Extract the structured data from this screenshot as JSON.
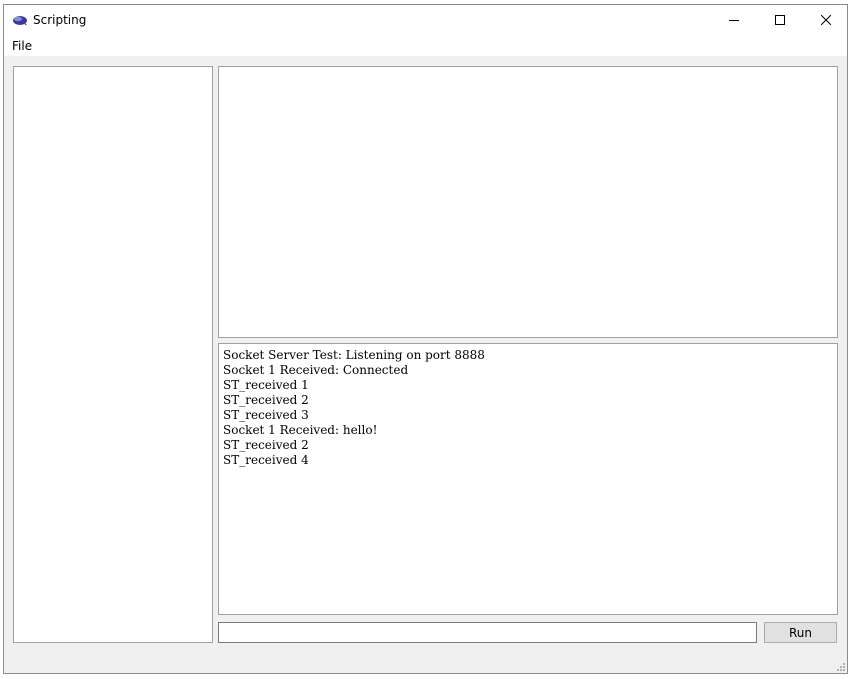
{
  "window": {
    "title": "Scripting",
    "icon": "scripting-app-icon"
  },
  "caption": {
    "minimize_icon": "minimize-icon",
    "maximize_icon": "maximize-icon",
    "close_icon": "close-icon"
  },
  "menu": {
    "items": [
      {
        "label": "File"
      }
    ]
  },
  "console": {
    "lines": [
      "Socket Server Test: Listening on port 8888",
      "Socket 1 Received: Connected",
      "ST_received 1",
      "ST_received 2",
      "ST_received 3",
      "Socket 1 Received: hello!",
      "ST_received 2",
      "ST_received 4"
    ]
  },
  "command": {
    "value": "",
    "run_label": "Run"
  },
  "colors": {
    "window_bg": "#f0f0f0",
    "panel_border": "#a0a0a0",
    "button_bg": "#e1e1e1",
    "app_icon": "#3b3b9a"
  }
}
